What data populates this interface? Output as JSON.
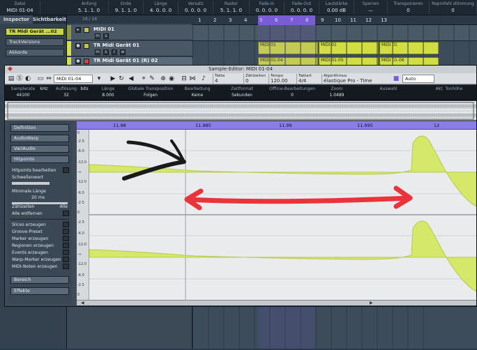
{
  "infoline": {
    "columns": [
      {
        "h": "Datei",
        "v": "MIDI 01-04"
      },
      {
        "h": "Anfang",
        "v": "5. 1. 1. 0"
      },
      {
        "h": "Ende",
        "v": "9. 1. 1. 0"
      },
      {
        "h": "Länge",
        "v": "4. 0. 0. 0"
      },
      {
        "h": "Versatz",
        "v": "0. 0. 0. 0"
      },
      {
        "h": "Raster",
        "v": "5. 1. 1. 0"
      },
      {
        "h": "Fade-In",
        "v": "0. 0. 0. 0"
      },
      {
        "h": "Fade-Out",
        "v": "0. 0. 0. 0"
      },
      {
        "h": "Lautstärke",
        "v": "0.00 dB"
      },
      {
        "h": "Sperren",
        "v": "—"
      },
      {
        "h": "Transponieren",
        "v": "0"
      },
      {
        "h": "Reprofahl stimmung",
        "v": "0"
      }
    ]
  },
  "inspector": {
    "tabs": [
      "Inspector",
      "Sichtbarkeit"
    ],
    "track_name": "TR Midi Gerät ...02",
    "rows": [
      "TrackVersions",
      "Akkorde"
    ]
  },
  "tracklist": {
    "counter": "16 / 16",
    "tracks": [
      {
        "name": "MIDI 01"
      },
      {
        "name": "TR Midi Gerät 01"
      },
      {
        "name": "TR Midi Gerät 01 (R) 02"
      }
    ]
  },
  "arrange": {
    "bars": [
      "1",
      "2",
      "3",
      "4",
      "5",
      "6",
      "7",
      "8",
      "9",
      "10",
      "11",
      "12",
      "13"
    ],
    "parts": [
      "MIDI 01",
      "MIDI 01",
      "MIDI 01",
      "MIDI 01-04",
      "MIDI 01-05",
      "MIDI 01-06"
    ]
  },
  "editor": {
    "title": "Sample-Editor: MIDI 01-04",
    "toolbar": {
      "event_select": "MIDI 01-04",
      "fields": [
        {
          "h": "Takte",
          "v": "4"
        },
        {
          "h": "Zählzeiten",
          "v": "0"
        },
        {
          "h": "Tempo",
          "v": "120.00"
        },
        {
          "h": "Taktart",
          "v": "4/4"
        },
        {
          "h": "Algorithmus",
          "v": "élastique Pro - Time"
        }
      ],
      "auto_label": "Auto"
    },
    "info": [
      {
        "h": "Samplerate",
        "v": "44100"
      },
      {
        "h": "",
        "v": "kHz"
      },
      {
        "h": "Auflösung",
        "v": "32"
      },
      {
        "h": "",
        "v": "bits"
      },
      {
        "h": "Länge",
        "v": "8.000"
      },
      {
        "h": "Globale Transposition",
        "v": "Folgen"
      },
      {
        "h": "Bearbeitung",
        "v": "Keine"
      },
      {
        "h": "Zeitformat",
        "v": "Sekunden"
      },
      {
        "h": "Offline-Bearbeitungen",
        "v": "0"
      },
      {
        "h": "Zoom",
        "v": "1.0489"
      },
      {
        "h": "Auswahl",
        "v": ""
      },
      {
        "h": "Akt. Tonhöhe",
        "v": ""
      }
    ],
    "inspector": {
      "sections": [
        "Definition",
        "AudioWarp",
        "VariAudio",
        "Hitpoints"
      ],
      "hitpoints_items": [
        "Hitpoints bearbeiten",
        "Schwellenwert",
        "Minimale Länge",
        "20 ms",
        "Zählzeiten",
        "Alle entfernen"
      ],
      "zaehlzeiten_value": "Alle",
      "action_items": [
        "Slices erzeugen",
        "Groove-Preset",
        "Marker erzeugen",
        "Regionen erzeugen",
        "Events erzeugen",
        "Warp-Marker erzeugen",
        "MIDI-Noten erzeugen"
      ],
      "bottom_sections": [
        "Bereich",
        "Effekte"
      ]
    },
    "wave_ruler": [
      "11.98",
      "11.985",
      "11.99",
      "11.995",
      "12"
    ],
    "db_labels": [
      "0",
      "-2.5",
      "-6.0",
      "-12.0",
      "-∞",
      "-12.0",
      "-6.0",
      "-2.5",
      "0",
      "-2.5",
      "-6.0",
      "-12.0",
      "-∞",
      "-12.0",
      "-6.0",
      "-2.5",
      "0"
    ],
    "colors": {
      "wave": "#d6e86a",
      "ruler": "#8a7de8",
      "annot_red": "#e8343a",
      "annot_black": "#1a1a1a"
    }
  }
}
